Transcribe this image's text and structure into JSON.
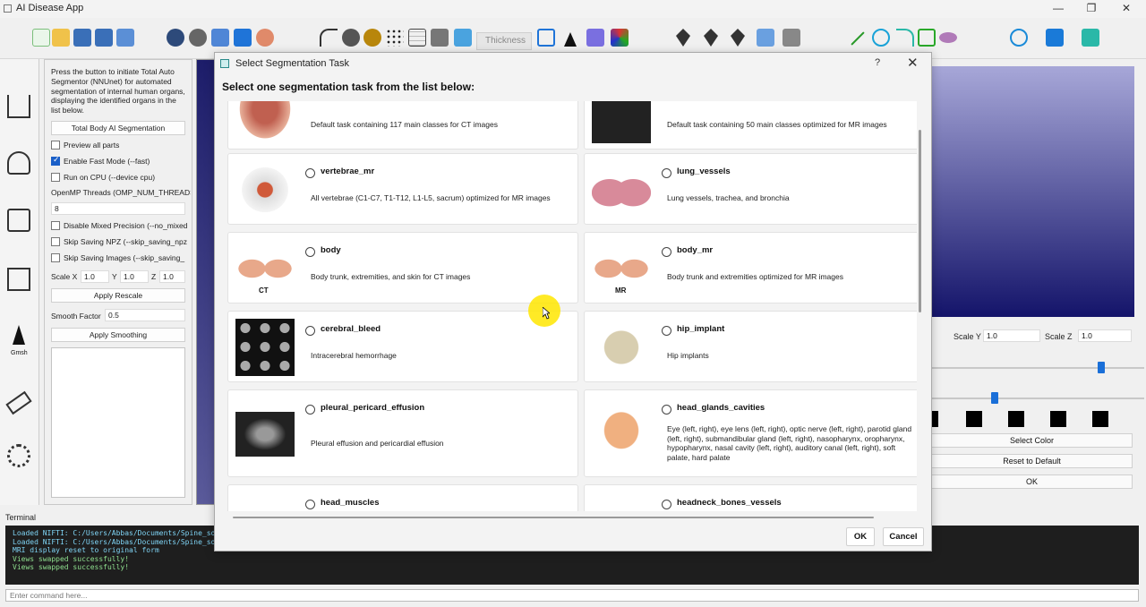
{
  "app": {
    "title": "AI Disease App"
  },
  "toolbar": {
    "thickness_placeholder": "Thickness"
  },
  "control_panel": {
    "description": "Press the button to initiate Total Auto Segmentor (NNUnet) for automated segmentation of internal human organs, displaying the identified organs in the list below.",
    "seg_button": "Total Body AI Segmentation",
    "preview_all": "Preview all parts",
    "fast_mode": "Enable Fast Mode (--fast)",
    "run_cpu": "Run on CPU (--device cpu)",
    "threads_label": "OpenMP Threads (OMP_NUM_THREADS",
    "threads_value": "8",
    "disable_mixed": "Disable Mixed Precision (--no_mixed",
    "skip_npz": "Skip Saving NPZ (--skip_saving_npz",
    "skip_images": "Skip Saving Images (--skip_saving_",
    "scale_x_label": "Scale X",
    "scale_x": "1.0",
    "scale_y_label": "Y",
    "scale_y": "1.0",
    "scale_z_label": "Z",
    "scale_z": "1.0",
    "apply_rescale": "Apply Rescale",
    "smooth_label": "Smooth Factor",
    "smooth_value": "0.5",
    "apply_smoothing": "Apply Smoothing"
  },
  "left_strip": {
    "gmsh_label": "Gmsh"
  },
  "right_panel": {
    "scale_y_label": "Scale Y",
    "scale_y": "1.0",
    "scale_z_label": "Scale Z",
    "scale_z": "1.0",
    "select_color": "Select Color",
    "reset_default": "Reset to Default",
    "ok": "OK"
  },
  "terminal": {
    "label": "Terminal",
    "lines": [
      "Loaded NIFTI: C:/Users/Abbas/Documents/Spine_sof",
      "Loaded NIFTI: C:/Users/Abbas/Documents/Spine_sof",
      "MRI display reset to original form",
      "Views swapped successfully!",
      "Views swapped successfully!"
    ],
    "input_placeholder": "Enter command here..."
  },
  "dialog": {
    "title": "Select Segmentation Task",
    "help": "?",
    "close": "✕",
    "heading": "Select one segmentation task from the list below:",
    "ok": "OK",
    "cancel": "Cancel",
    "tasks": [
      {
        "name": "",
        "desc": "Default task containing 117 main classes for CT images"
      },
      {
        "name": "",
        "desc": "Default task containing 50 main classes optimized for MR images"
      },
      {
        "name": "vertebrae_mr",
        "desc": "All vertebrae (C1-C7, T1-T12, L1-L5, sacrum) optimized for MR images"
      },
      {
        "name": "lung_vessels",
        "desc": "Lung vessels, trachea, and bronchia"
      },
      {
        "name": "body",
        "desc": "Body trunk, extremities, and skin for CT images",
        "thumb_tag": "CT"
      },
      {
        "name": "body_mr",
        "desc": "Body trunk and extremities optimized for MR images",
        "thumb_tag": "MR"
      },
      {
        "name": "cerebral_bleed",
        "desc": "Intracerebral hemorrhage"
      },
      {
        "name": "hip_implant",
        "desc": "Hip implants"
      },
      {
        "name": "pleural_pericard_effusion",
        "desc": "Pleural effusion and pericardial effusion"
      },
      {
        "name": "head_glands_cavities",
        "desc": "Eye (left, right), eye lens (left, right), optic nerve (left, right), parotid gland (left, right), submandibular gland (left, right), nasopharynx, oropharynx, hypopharynx, nasal cavity (left, right), auditory canal (left, right), soft palate, hard palate"
      },
      {
        "name": "head_muscles",
        "desc": ""
      },
      {
        "name": "headneck_bones_vessels",
        "desc": ""
      }
    ]
  },
  "colors": {
    "accent": "#1a5fc8",
    "terminal_bg": "#1e1e1e",
    "view_dark": "#14146a",
    "view_light": "#a7a7d8"
  },
  "icons": [
    "new-file-icon",
    "open-folder-icon",
    "save-stl-icon",
    "save-step-icon",
    "export-feb-icon",
    "brain-scan-icon",
    "swap-views-icon",
    "anatomy-icon",
    "curve-icon",
    "mesh-sphere-icon",
    "grid-icon",
    "cube-icon",
    "line-icon",
    "circle-icon",
    "rectangle-icon",
    "target-icon",
    "square-icon",
    "box-icon"
  ]
}
